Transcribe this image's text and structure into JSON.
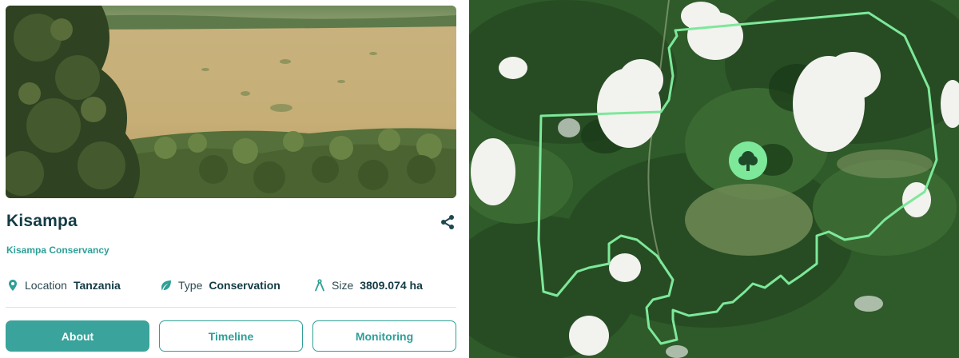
{
  "project": {
    "name": "Kisampa",
    "organization": "Kisampa Conservancy"
  },
  "details": {
    "location": {
      "label": "Location",
      "value": "Tanzania",
      "icon": "location-pin-icon"
    },
    "type": {
      "label": "Type",
      "value": "Conservation",
      "icon": "leaf-icon"
    },
    "size": {
      "label": "Size",
      "value": "3809.074 ha",
      "icon": "compass-icon"
    }
  },
  "tabs": {
    "about": "About",
    "timeline": "Timeline",
    "monitoring": "Monitoring"
  },
  "active_tab": "About",
  "map": {
    "boundary_color": "#7de89a",
    "marker_color": "#7de89a",
    "marker_icon": "tree-icon"
  },
  "colors": {
    "accent": "#3aa39b",
    "title": "#133b45"
  }
}
